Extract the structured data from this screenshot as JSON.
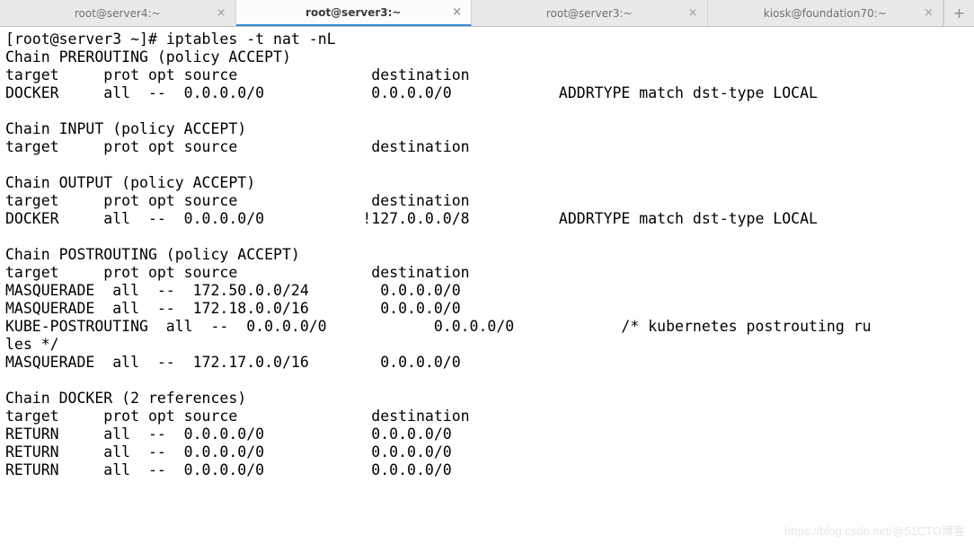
{
  "tabs": [
    {
      "label": "root@server4:~",
      "active": false
    },
    {
      "label": "root@server3:~",
      "active": true
    },
    {
      "label": "root@server3:~",
      "active": false
    },
    {
      "label": "kiosk@foundation70:~",
      "active": false
    }
  ],
  "close_glyph": "×",
  "add_glyph": "+",
  "prompt": "[root@server3 ~]# ",
  "command": "iptables -t nat -nL",
  "lines": [
    "Chain PREROUTING (policy ACCEPT)",
    "target     prot opt source               destination         ",
    "DOCKER     all  --  0.0.0.0/0            0.0.0.0/0            ADDRTYPE match dst-type LOCAL",
    "",
    "Chain INPUT (policy ACCEPT)",
    "target     prot opt source               destination         ",
    "",
    "Chain OUTPUT (policy ACCEPT)",
    "target     prot opt source               destination         ",
    "DOCKER     all  --  0.0.0.0/0           !127.0.0.0/8          ADDRTYPE match dst-type LOCAL",
    "",
    "Chain POSTROUTING (policy ACCEPT)",
    "target     prot opt source               destination         ",
    "MASQUERADE  all  --  172.50.0.0/24        0.0.0.0/0           ",
    "MASQUERADE  all  --  172.18.0.0/16        0.0.0.0/0           ",
    "KUBE-POSTROUTING  all  --  0.0.0.0/0            0.0.0.0/0            /* kubernetes postrouting ru",
    "les */",
    "MASQUERADE  all  --  172.17.0.0/16        0.0.0.0/0           ",
    "",
    "Chain DOCKER (2 references)",
    "target     prot opt source               destination         ",
    "RETURN     all  --  0.0.0.0/0            0.0.0.0/0           ",
    "RETURN     all  --  0.0.0.0/0            0.0.0.0/0           ",
    "RETURN     all  --  0.0.0.0/0            0.0.0.0/0           "
  ],
  "watermark": "https://blog.csdn.net/@51CTO博客"
}
